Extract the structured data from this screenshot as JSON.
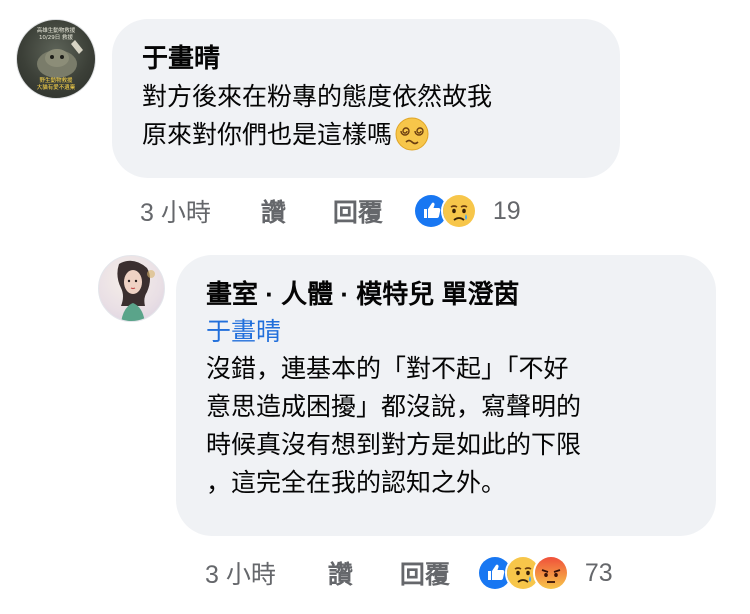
{
  "comment": {
    "avatar_text_top": "高雄生動物救援\n10/29日 救援",
    "avatar_text_bottom": "野生動物救援\n大貓有愛不遺棄",
    "author": "于畫晴",
    "lines": [
      "對方後來在粉專的態度依然故我",
      "原來對你們也是這樣嗎"
    ],
    "emoji_icon": "dizzy-face-emoji",
    "time": "3 小時",
    "like_label": "讚",
    "reply_label": "回覆",
    "reaction_icons": [
      "like-reaction",
      "sad-reaction"
    ],
    "reaction_count": "19"
  },
  "reply": {
    "author": "畫室 · 人體 · 模特兒 單澄茵",
    "mention": "于畫晴",
    "lines": [
      "沒錯，連基本的「對不起」「不好",
      "意思造成困擾」都沒說，寫聲明的",
      "時候真沒有想到對方是如此的下限",
      "，這完全在我的認知之外。"
    ],
    "time": "3 小時",
    "like_label": "讚",
    "reply_label": "回覆",
    "reaction_icons": [
      "like-reaction",
      "sad-reaction",
      "angry-reaction"
    ],
    "reaction_count": "73"
  },
  "colors": {
    "bubble": "#f0f2f5",
    "mention": "#216fdb",
    "meta": "#65676b",
    "like_blue": "#1877f2",
    "emoji_yellow": "#f7c64a",
    "angry_red": "#f0503a"
  }
}
